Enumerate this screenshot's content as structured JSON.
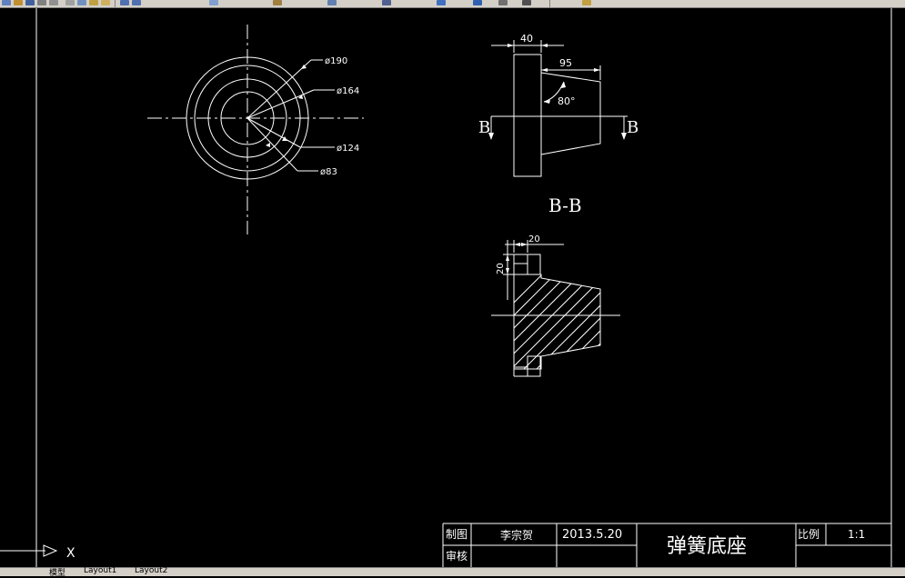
{
  "colors": {
    "background": "#000000",
    "lines": "#ffffff",
    "toolbar": "#d4d0c8"
  },
  "toolbar": {
    "icons": [
      "new-icon",
      "open-icon",
      "save-icon",
      "print-icon",
      "preview-icon",
      "cut-icon",
      "copy-icon",
      "paste-icon",
      "match-icon",
      "undo-icon",
      "redo-icon",
      "pan-icon",
      "zoom-icon",
      "zoom-window-icon",
      "zoom-previous-icon",
      "properties-icon",
      "design-center-icon",
      "tool-palette-icon",
      "calculator-icon",
      "help-icon"
    ]
  },
  "view_top": {
    "diameters": [
      "ø190",
      "ø164",
      "ø124",
      "ø83"
    ]
  },
  "view_front": {
    "dim_width": "40",
    "dim_length": "95",
    "dim_angle": "80°",
    "section_mark_left": "B",
    "section_mark_right": "B"
  },
  "view_section": {
    "title": "B-B",
    "dim_horizontal": "20",
    "dim_vertical": "20"
  },
  "title_block": {
    "drawn_label": "制图",
    "drawer_name": "李宗贺",
    "date": "2013.5.20",
    "drawing_title": "弹簧底座",
    "scale_label": "比例",
    "scale_value": "1:1",
    "review_label": "审核"
  },
  "ucs": {
    "x_label": "X"
  },
  "layout_tabs": [
    "模型",
    "Layout1",
    "Layout2"
  ]
}
